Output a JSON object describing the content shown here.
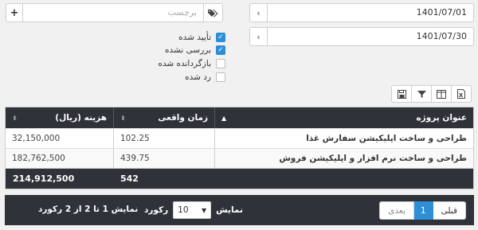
{
  "filters": {
    "date_from": "1401/07/01",
    "date_to": "1401/07/30",
    "tag_placeholder": "برچسب",
    "statuses": [
      {
        "label": "تأیید شده",
        "checked": true
      },
      {
        "label": "بررسی نشده",
        "checked": true
      },
      {
        "label": "بازگردانده شده",
        "checked": false
      },
      {
        "label": "رد شده",
        "checked": false
      }
    ]
  },
  "toolbar": {
    "icons": [
      "excel-export-icon",
      "columns-icon",
      "filter-icon",
      "save-icon"
    ]
  },
  "table": {
    "headers": {
      "title": "عنوان پروژه",
      "actual_time": "زمان واقعی",
      "cost": "هزینه (ریال)"
    },
    "rows": [
      {
        "title": "طراحی و ساخت اپلیکیشن سفارش غذا",
        "actual_time": "102.25",
        "cost": "32,150,000"
      },
      {
        "title": "طراحی و ساخت نرم افزار و اپلیکیشن فروش",
        "actual_time": "439.75",
        "cost": "182,762,500"
      }
    ],
    "totals": {
      "actual_time": "542",
      "cost": "214,912,500"
    }
  },
  "pagination": {
    "prev_label": "قبلی",
    "current_page": "1",
    "next_label": "بعدی",
    "show_label": "نمایش",
    "page_size": "10",
    "records_label": "رکورد",
    "info": "نمایش 1 تا 2 از 2 رکورد"
  },
  "colors": {
    "accent": "#2f8fd6",
    "header_bg": "#2f3238"
  }
}
